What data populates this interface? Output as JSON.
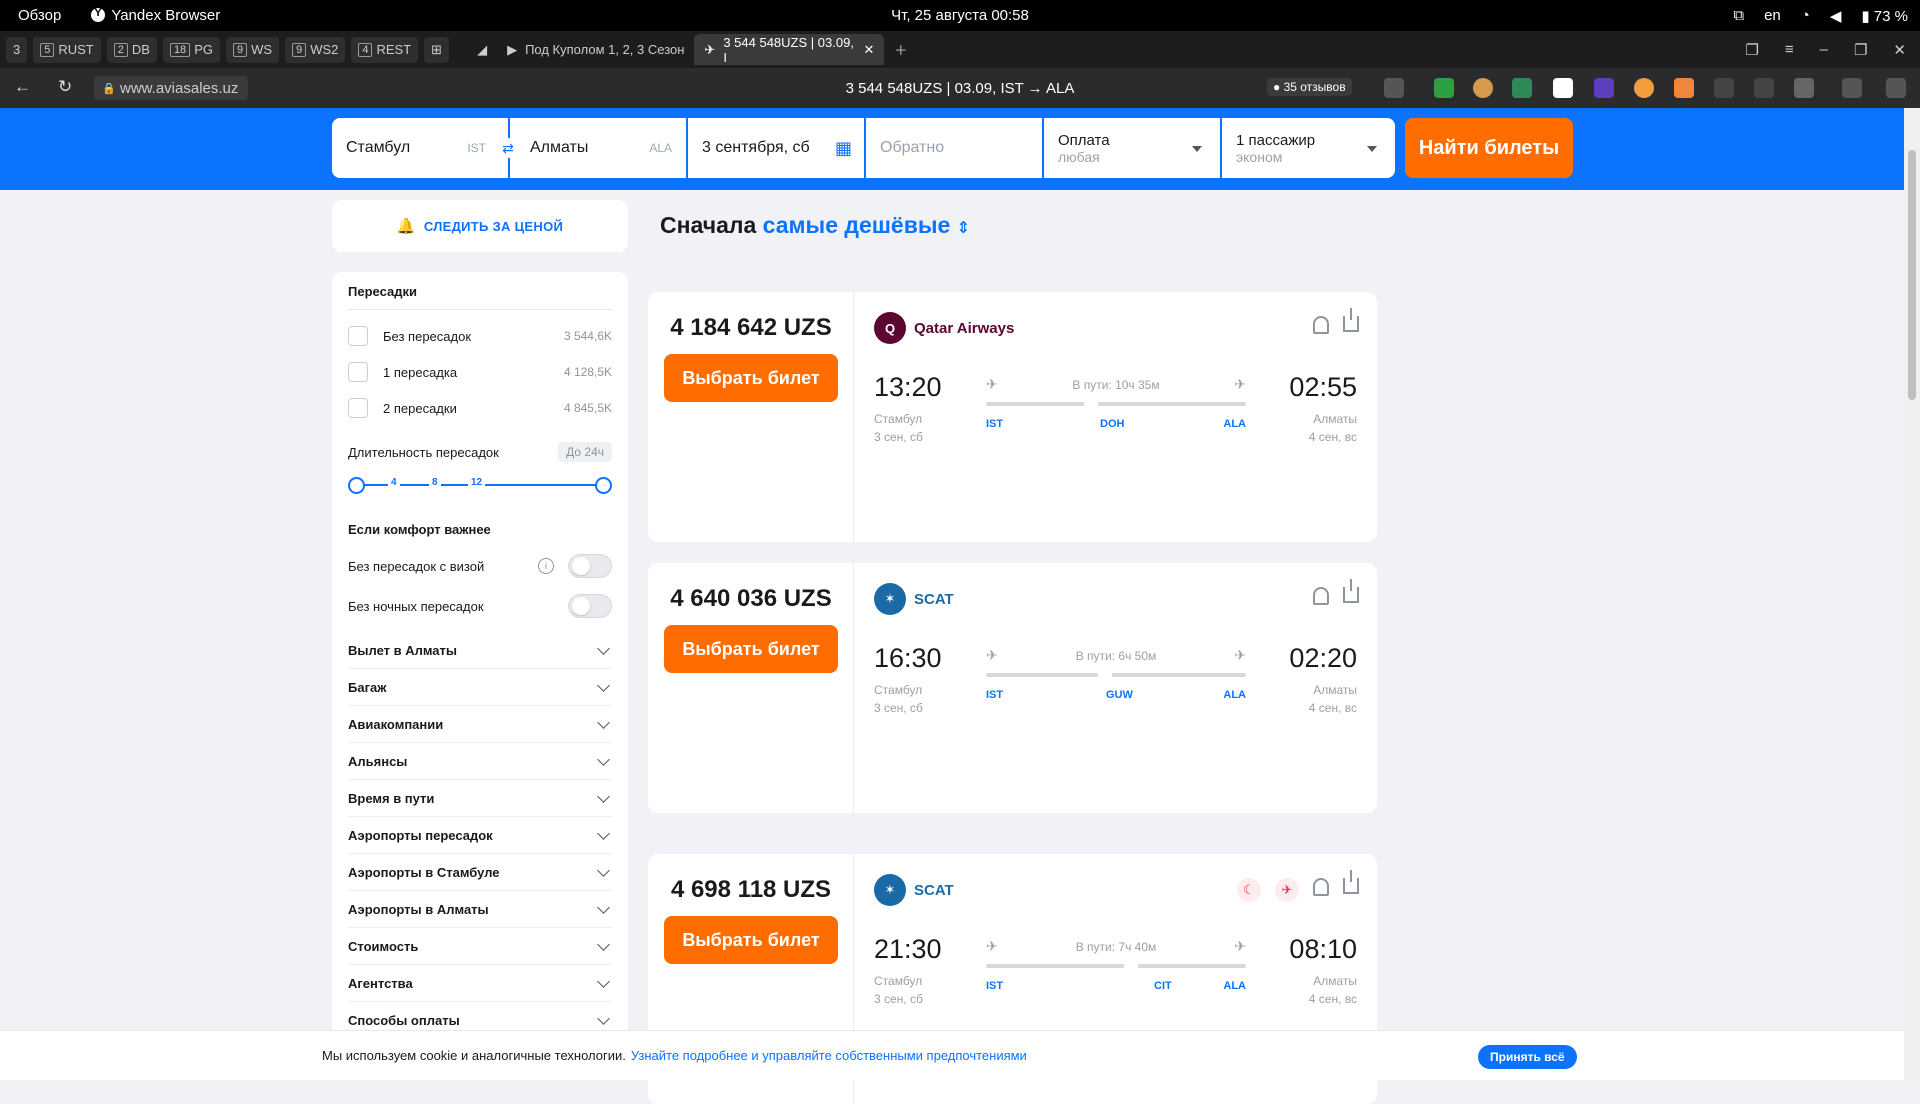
{
  "os": {
    "overview": "Обзор",
    "app": "Yandex Browser",
    "datetime": "Чт, 25 августа  00:58",
    "lang": "en",
    "battery": "73 %"
  },
  "workspaces": [
    {
      "num": "3",
      "label": ""
    },
    {
      "num": "5",
      "label": "RUST"
    },
    {
      "num": "2",
      "label": "DB"
    },
    {
      "num": "18",
      "label": "PG"
    },
    {
      "num": "9",
      "label": "WS"
    },
    {
      "num": "9",
      "label": "WS2"
    },
    {
      "num": "4",
      "label": "REST"
    }
  ],
  "tabs": [
    {
      "label": "Под Куполом 1, 2, 3 Сезон"
    },
    {
      "label": "3 544 548UZS | 03.09, I"
    }
  ],
  "address": {
    "url": "www.aviasales.uz",
    "title": "3 544 548UZS | 03.09, IST → ALA",
    "reviews": "35 отзывов"
  },
  "search": {
    "from": "Стамбул",
    "from_code": "IST",
    "to": "Алматы",
    "to_code": "ALA",
    "date": "3 сентября, сб",
    "return_placeholder": "Обратно",
    "payment_label": "Оплата",
    "payment_value": "любая",
    "passengers": "1 пассажир",
    "class": "эконом",
    "find_button": "Найти билеты"
  },
  "sidebar": {
    "watch_price": "СЛЕДИТЬ ЗА ЦЕНОЙ",
    "stops_title": "Пересадки",
    "stops": [
      {
        "label": "Без пересадок",
        "price": "3 544,6K"
      },
      {
        "label": "1 пересадка",
        "price": "4 128,5K"
      },
      {
        "label": "2 пересадки",
        "price": "4 845,5K"
      }
    ],
    "duration_label": "Длительность пересадок",
    "duration_badge": "До 24ч",
    "slider_ticks": [
      "4",
      "8",
      "12"
    ],
    "comfort_title": "Если комфорт важнее",
    "toggles": [
      {
        "label": "Без пересадок с визой"
      },
      {
        "label": "Без ночных пересадок"
      }
    ],
    "sections": [
      "Вылет в Алматы",
      "Багаж",
      "Авиакомпании",
      "Альянсы",
      "Время в пути",
      "Аэропорты пересадок",
      "Аэропорты в Стамбуле",
      "Аэропорты в Алматы",
      "Стоимость",
      "Агентства",
      "Способы оплаты"
    ]
  },
  "sort": {
    "prefix": "Сначала",
    "value": "самые дешёвые"
  },
  "tickets": [
    {
      "price": "4 184 642 UZS",
      "buy": "Выбрать билет",
      "airline": "Qatar Airways",
      "logo_color": "#5c0632",
      "dep_time": "13:20",
      "dep_city": "Стамбул",
      "dep_date": "3 сен, сб",
      "arr_time": "02:55",
      "arr_city": "Алматы",
      "arr_date": "4 сен, вс",
      "duration": "В пути: 10ч 35м",
      "airports": [
        "IST",
        "DOH",
        "ALA"
      ]
    },
    {
      "price": "4 640 036 UZS",
      "buy": "Выбрать билет",
      "airline": "SCAT",
      "logo_color": "#1b6aa8",
      "dep_time": "16:30",
      "dep_city": "Стамбул",
      "dep_date": "3 сен, сб",
      "arr_time": "02:20",
      "arr_city": "Алматы",
      "arr_date": "4 сен, вс",
      "duration": "В пути: 6ч 50м",
      "airports": [
        "IST",
        "GUW",
        "ALA"
      ]
    },
    {
      "price": "4 698 118 UZS",
      "buy": "Выбрать билет",
      "airline": "SCAT",
      "logo_color": "#1b6aa8",
      "dep_time": "21:30",
      "dep_city": "Стамбул",
      "dep_date": "3 сен, сб",
      "arr_time": "08:10",
      "arr_city": "Алматы",
      "arr_date": "4 сен, вс",
      "duration": "В пути: 7ч 40м",
      "airports": [
        "IST",
        "CIT",
        "ALA"
      ]
    }
  ],
  "cookie": {
    "text": "Мы используем cookie и аналогичные технологии.",
    "link": "Узнайте подробнее и управляйте собственными предпочтениями",
    "accept": "Принять всё"
  },
  "colors": {
    "brand_blue": "#0c73fe",
    "accent_orange": "#ff6d00"
  }
}
